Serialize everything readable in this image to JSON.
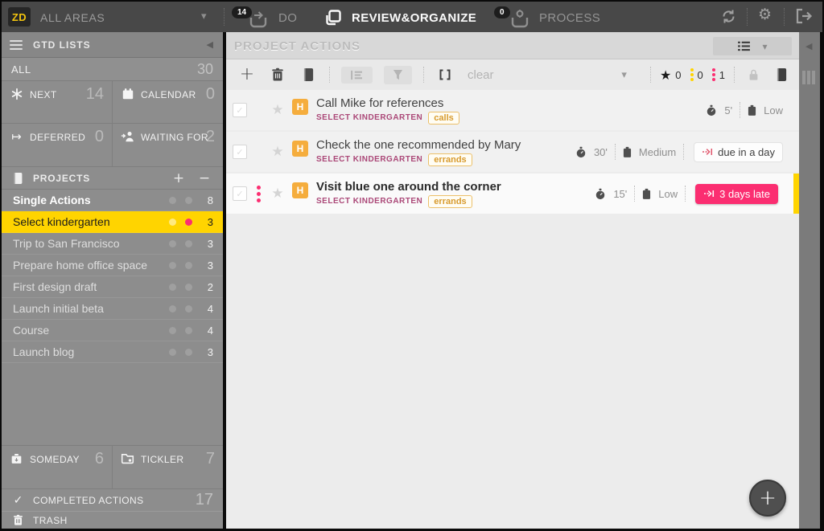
{
  "topbar": {
    "workspace": "ZD",
    "area": "ALL AREAS",
    "do_tab": {
      "label": "DO",
      "count": "14"
    },
    "review_tab": {
      "label": "REVIEW&ORGANIZE"
    },
    "process_tab": {
      "label": "PROCESS",
      "count": "0"
    }
  },
  "sidebar": {
    "title": "GTD LISTS",
    "all": {
      "label": "ALL",
      "count": "30"
    },
    "lists": [
      {
        "label": "NEXT",
        "count": "14"
      },
      {
        "label": "CALENDAR",
        "count": "0"
      },
      {
        "label": "DEFERRED",
        "count": "0"
      },
      {
        "label": "WAITING FOR",
        "count": "2"
      }
    ],
    "projects": {
      "title": "PROJECTS",
      "items": [
        {
          "name": "Single Actions",
          "count": "8"
        },
        {
          "name": "Select kindergarten",
          "count": "3"
        },
        {
          "name": "Trip to San Francisco",
          "count": "3"
        },
        {
          "name": "Prepare home office space",
          "count": "3"
        },
        {
          "name": "First design draft",
          "count": "2"
        },
        {
          "name": "Launch initial beta",
          "count": "4"
        },
        {
          "name": "Course",
          "count": "4"
        },
        {
          "name": "Launch blog",
          "count": "3"
        }
      ]
    },
    "someday": {
      "label": "SOMEDAY",
      "count": "6"
    },
    "tickler": {
      "label": "TICKLER",
      "count": "7"
    },
    "completed": {
      "label": "COMPLETED ACTIONS",
      "count": "17"
    },
    "trash": {
      "label": "TRASH"
    }
  },
  "main": {
    "title": "PROJECT ACTIONS",
    "toolbar": {
      "clear": "clear",
      "star_count": "0",
      "yellow_count": "0",
      "pink_count": "1"
    },
    "tasks": [
      {
        "priority": "H",
        "title": "Call Mike for references",
        "project": "SELECT KINDERGARTEN",
        "tag": "calls",
        "time": "5'",
        "energy": "Low"
      },
      {
        "priority": "H",
        "title": "Check the one recommended by Mary",
        "project": "SELECT KINDERGARTEN",
        "tag": "errands",
        "time": "30'",
        "energy": "Medium",
        "due": "due in a day"
      },
      {
        "priority": "H",
        "title": "Visit blue one around the corner",
        "project": "SELECT KINDERGARTEN",
        "tag": "errands",
        "time": "15'",
        "energy": "Low",
        "due": "3 days late"
      }
    ]
  },
  "icons": {
    "chevron_down": "▾",
    "collapse_left": "◀",
    "deferred_arrow": "↦",
    "check": "✓",
    "star": "★",
    "plus": "+",
    "minus": "−",
    "gear": "⚙",
    "fab_plus": "+"
  },
  "colors": {
    "accent_yellow": "#ffd400",
    "accent_pink": "#fb2e71",
    "priority_orange": "#f5ad3d",
    "tag_yellow": "#d89b2e",
    "project_label_pink": "#ab4878"
  }
}
